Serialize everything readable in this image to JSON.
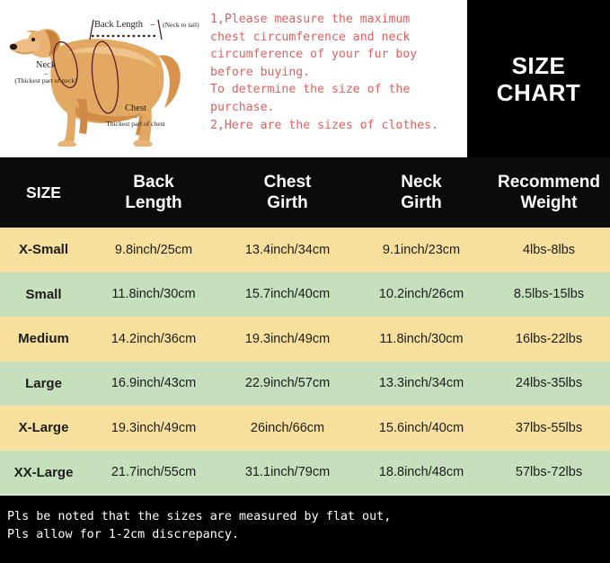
{
  "diagram": {
    "alt_name": "dog-measurement-diagram",
    "labels": {
      "back_length": "Back Length",
      "back_length_dash": "–",
      "back_length_note": "(Neck to tail)",
      "neck": "Neck",
      "neck_dash": "–",
      "neck_note": "(Thickest part of neck)",
      "chest": "Chest",
      "chest_dash": "–",
      "chest_note": "Thickest part of chest"
    },
    "colors": {
      "measure_line": "#5b1b2e",
      "dog_body": "#e0a561",
      "dog_light": "#f0cb96",
      "dog_dark": "#c0762f"
    }
  },
  "instructions": {
    "line1": "1,Please measure the maximum",
    "line2": "chest circumference and neck",
    "line3": "circumference of your fur boy",
    "line4": "before buying.",
    "line5": "To determine the size of the",
    "line6": "purchase.",
    "line7": "2,Here are the sizes of clothes.",
    "color": "#e2605f"
  },
  "title_block": {
    "line1": "SIZE",
    "line2": "CHART",
    "background": "#000000",
    "color": "#ffffff"
  },
  "table": {
    "headers": [
      "SIZE",
      "Back\nLength",
      "Chest\nGirth",
      "Neck\nGirth",
      "Recommend\nWeight"
    ],
    "header_parts": [
      {
        "l1": "SIZE",
        "l2": ""
      },
      {
        "l1": "Back",
        "l2": "Length"
      },
      {
        "l1": "Chest",
        "l2": "Girth"
      },
      {
        "l1": "Neck",
        "l2": "Girth"
      },
      {
        "l1": "Recommend",
        "l2": "Weight"
      }
    ],
    "row_colors": {
      "odd": "#f7e09d",
      "even": "#c6dfbd"
    },
    "rows": [
      {
        "size": "X-Small",
        "back_length": "9.8inch/25cm",
        "chest_girth": "13.4inch/34cm",
        "neck_girth": "9.1inch/23cm",
        "weight": "4lbs-8lbs"
      },
      {
        "size": "Small",
        "back_length": "11.8inch/30cm",
        "chest_girth": "15.7inch/40cm",
        "neck_girth": "10.2inch/26cm",
        "weight": "8.5lbs-15lbs"
      },
      {
        "size": "Medium",
        "back_length": "14.2inch/36cm",
        "chest_girth": "19.3inch/49cm",
        "neck_girth": "11.8inch/30cm",
        "weight": "16lbs-22lbs"
      },
      {
        "size": "Large",
        "back_length": "16.9inch/43cm",
        "chest_girth": "22.9inch/57cm",
        "neck_girth": "13.3inch/34cm",
        "weight": "24lbs-35lbs"
      },
      {
        "size": "X-Large",
        "back_length": "19.3inch/49cm",
        "chest_girth": "26inch/66cm",
        "neck_girth": "15.6inch/40cm",
        "weight": "37lbs-55lbs"
      },
      {
        "size": "XX-Large",
        "back_length": "21.7inch/55cm",
        "chest_girth": "31.1inch/79cm",
        "neck_girth": "18.8inch/48cm",
        "weight": "57lbs-72lbs"
      }
    ]
  },
  "footer": {
    "line1": "Pls be noted that the sizes are measured by flat out,",
    "line2": "Pls allow for 1-2cm discrepancy."
  }
}
